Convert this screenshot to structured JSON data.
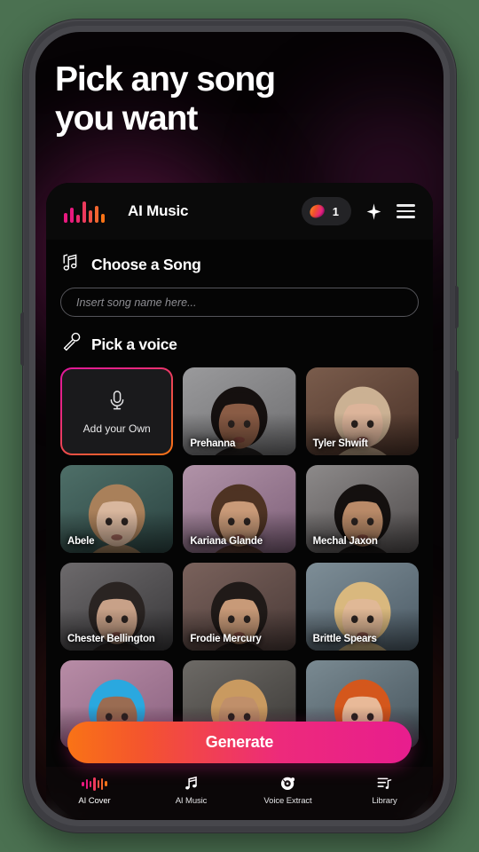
{
  "headline": "Pick any song\nyou want",
  "header": {
    "logo_icon": "waveform-logo-icon",
    "title": "AI Music",
    "credits_icon": "gem-icon",
    "credits_count": "1",
    "sparkle_icon": "sparkle-icon",
    "menu_icon": "hamburger-menu-icon"
  },
  "song_section": {
    "icon": "music-notes-icon",
    "label": "Choose a Song",
    "input_value": "",
    "input_placeholder": "Insert song name here..."
  },
  "voice_section": {
    "icon": "microphone-icon",
    "label": "Pick a voice",
    "add_own": {
      "icon": "microphone-icon",
      "label": "Add your Own"
    },
    "voices": [
      {
        "name": "Prehanna",
        "skin": "#8a5c45",
        "hair": "#15100f",
        "bg1": "#9a9a9c",
        "bg2": "#6e6e70"
      },
      {
        "name": "Tyler Shwift",
        "skin": "#dcb49a",
        "hair": "#cbb193",
        "bg1": "#7a5c4c",
        "bg2": "#4a3228"
      },
      {
        "name": "Abele",
        "skin": "#d9b79e",
        "hair": "#a9805a",
        "bg1": "#4e6f68",
        "bg2": "#2b4341"
      },
      {
        "name": "Kariana Glande",
        "skin": "#c99a78",
        "hair": "#4e3323",
        "bg1": "#b193a8",
        "bg2": "#7d5f78"
      },
      {
        "name": "Mechal Jaxon",
        "skin": "#b98a68",
        "hair": "#14100f",
        "bg1": "#8d8a8a",
        "bg2": "#4f4b4b"
      },
      {
        "name": "Chester Bellington",
        "skin": "#c8a188",
        "hair": "#2a2422",
        "bg1": "#6d6a6c",
        "bg2": "#39383a"
      },
      {
        "name": "Frodie Mercury",
        "skin": "#c89a78",
        "hair": "#201a18",
        "bg1": "#7a625c",
        "bg2": "#4a3a37"
      },
      {
        "name": "Brittle Spears",
        "skin": "#e0b896",
        "hair": "#d9b87e",
        "bg1": "#7e8e97",
        "bg2": "#4c5b66"
      },
      {
        "name": "",
        "skin": "#9a6c52",
        "hair": "#2aa8df",
        "bg1": "#b88ca6",
        "bg2": "#8a6280"
      },
      {
        "name": "",
        "skin": "#c08f6a",
        "hair": "#c99a60",
        "bg1": "#6d6a66",
        "bg2": "#3b3936"
      },
      {
        "name": "",
        "skin": "#e8b998",
        "hair": "#d4571c",
        "bg1": "#7a8a92",
        "bg2": "#46545c"
      }
    ]
  },
  "generate_button": "Generate",
  "bottom_nav": [
    {
      "label": "AI Cover",
      "icon": "waveform-icon",
      "active": true
    },
    {
      "label": "AI Music",
      "icon": "music-note-icon",
      "active": false
    },
    {
      "label": "Voice Extract",
      "icon": "vinyl-disc-icon",
      "active": false
    },
    {
      "label": "Library",
      "icon": "library-list-icon",
      "active": false
    }
  ],
  "colors": {
    "accent_pink": "#e81d8e",
    "accent_orange": "#f97316",
    "screen_bg": "#060305",
    "device_frame": "#3d3d42",
    "outer_bg": "#4b7151"
  }
}
